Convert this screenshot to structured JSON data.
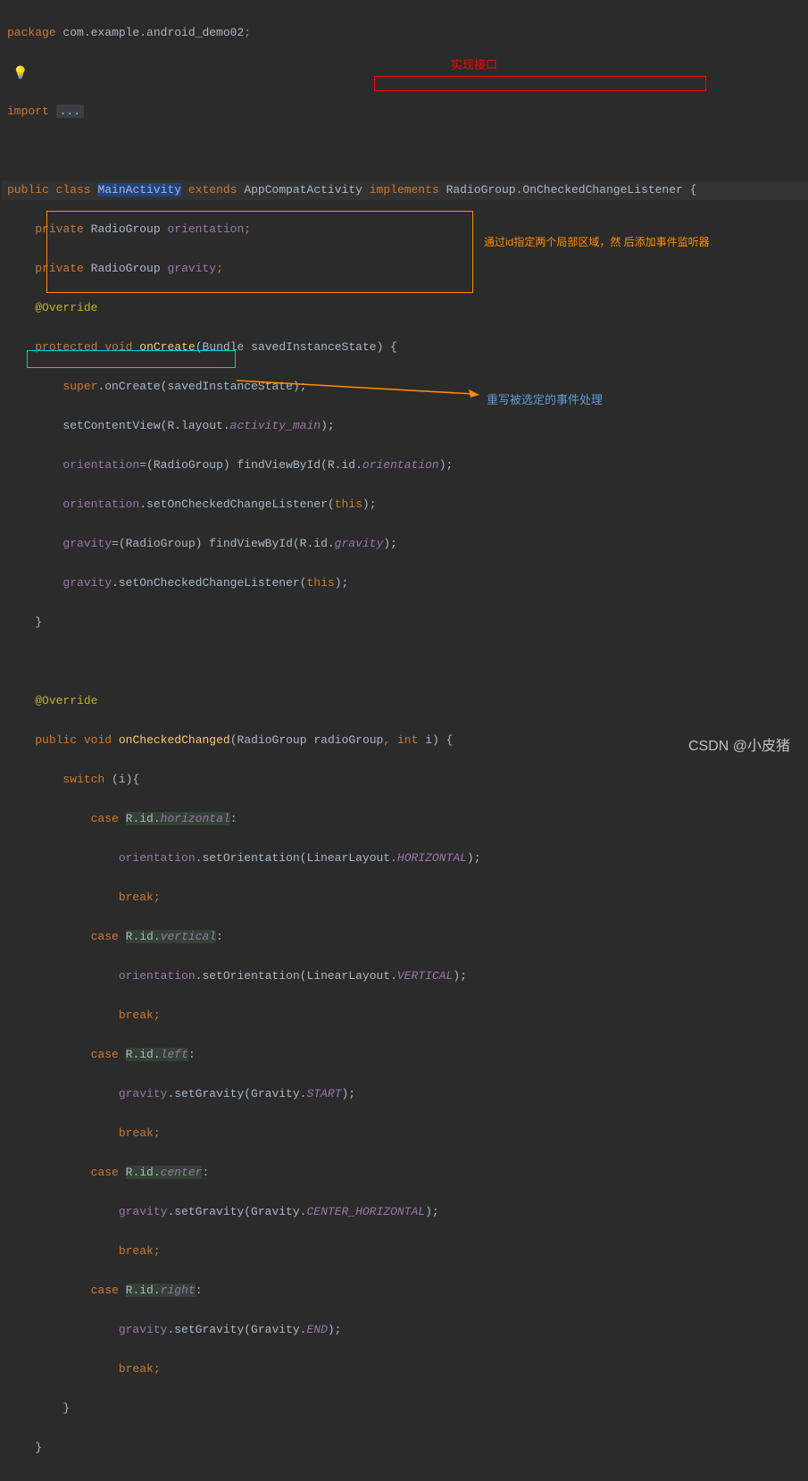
{
  "line1": {
    "package": "package",
    "path": "com.example.android_demo02",
    "semi": ";"
  },
  "line3": {
    "import": "import",
    "fold": "..."
  },
  "line5": {
    "public": "public",
    "class": "class",
    "name": "MainActivity",
    "extends": "extends",
    "parent": "AppCompatActivity",
    "implements": "implements",
    "iface": "RadioGroup.OnCheckedChangeListener",
    "brace": " {"
  },
  "line6": {
    "private": "private",
    "type": "RadioGroup",
    "field": "orientation",
    "semi": ";"
  },
  "line7": {
    "private": "private",
    "type": "RadioGroup",
    "field": "gravity",
    "semi": ";"
  },
  "line8": {
    "anno": "@Override"
  },
  "line9": {
    "protected": "protected",
    "void": "void",
    "name": "onCreate",
    "p1t": "Bundle",
    "p1n": "savedInstanceState",
    "brace": ") {"
  },
  "line10": {
    "super": "super",
    "dot": ".",
    "call": "onCreate",
    "arg": "savedInstanceState",
    "end": ");"
  },
  "line11": {
    "call": "setContentView",
    "r": "R.layout.",
    "f": "activity_main",
    "end": ");"
  },
  "line12": {
    "field": "orientation",
    "eq": "=(RadioGroup) findViewById(R.id.",
    "id": "orientation",
    "end": ");"
  },
  "line13": {
    "field": "orientation",
    "dot": ".setOnCheckedChangeListener(",
    "this": "this",
    "end": ");"
  },
  "line14": {
    "field": "gravity",
    "eq": "=(RadioGroup) findViewById(R.id.",
    "id": "gravity",
    "end": ");"
  },
  "line15": {
    "field": "gravity",
    "dot": ".setOnCheckedChangeListener(",
    "this": "this",
    "end": ");"
  },
  "line16": {
    "brace": "}"
  },
  "line18": {
    "anno": "@Override"
  },
  "line19": {
    "public": "public",
    "void": "void",
    "name": "onCheckedChanged",
    "p1t": "RadioGroup",
    "p1n": "radioGroup",
    "p2t": "int",
    "p2n": "i",
    "brace": ") {"
  },
  "line20": {
    "switch": "switch",
    "arg": "i",
    "brace": "){"
  },
  "line21": {
    "case": "case",
    "rid": "R.id.",
    "f": "horizontal",
    "colon": ":"
  },
  "line22": {
    "field": "orientation",
    "call": ".setOrientation(LinearLayout.",
    "const": "HORIZONTAL",
    "end": ");"
  },
  "line23": {
    "break": "break",
    "semi": ";"
  },
  "line24": {
    "case": "case",
    "rid": "R.id.",
    "f": "vertical",
    "colon": ":"
  },
  "line25": {
    "field": "orientation",
    "call": ".setOrientation(LinearLayout.",
    "const": "VERTICAL",
    "end": ");"
  },
  "line26": {
    "break": "break",
    "semi": ";"
  },
  "line27": {
    "case": "case",
    "rid": "R.id.",
    "f": "left",
    "colon": ":"
  },
  "line28": {
    "field": "gravity",
    "call": ".setGravity(Gravity.",
    "const": "START",
    "end": ");"
  },
  "line29": {
    "break": "break",
    "semi": ";"
  },
  "line30": {
    "case": "case",
    "rid": "R.id.",
    "f": "center",
    "colon": ":"
  },
  "line31": {
    "field": "gravity",
    "call": ".setGravity(Gravity.",
    "const": "CENTER_HORIZONTAL",
    "end": ");"
  },
  "line32": {
    "break": "break",
    "semi": ";"
  },
  "line33": {
    "case": "case",
    "rid": "R.id.",
    "f": "right",
    "colon": ":"
  },
  "line34": {
    "field": "gravity",
    "call": ".setGravity(Gravity.",
    "const": "END",
    "end": ");"
  },
  "line35": {
    "break": "break",
    "semi": ";"
  },
  "line36": {
    "brace": "}"
  },
  "line37": {
    "brace": "}"
  },
  "annotations": {
    "red": "实现接口",
    "orange": "通过id指定两个局部区域，然\n后添加事件监听器",
    "blue": "重写被选定的事件处理"
  },
  "watermark": "CSDN @小皮猪"
}
